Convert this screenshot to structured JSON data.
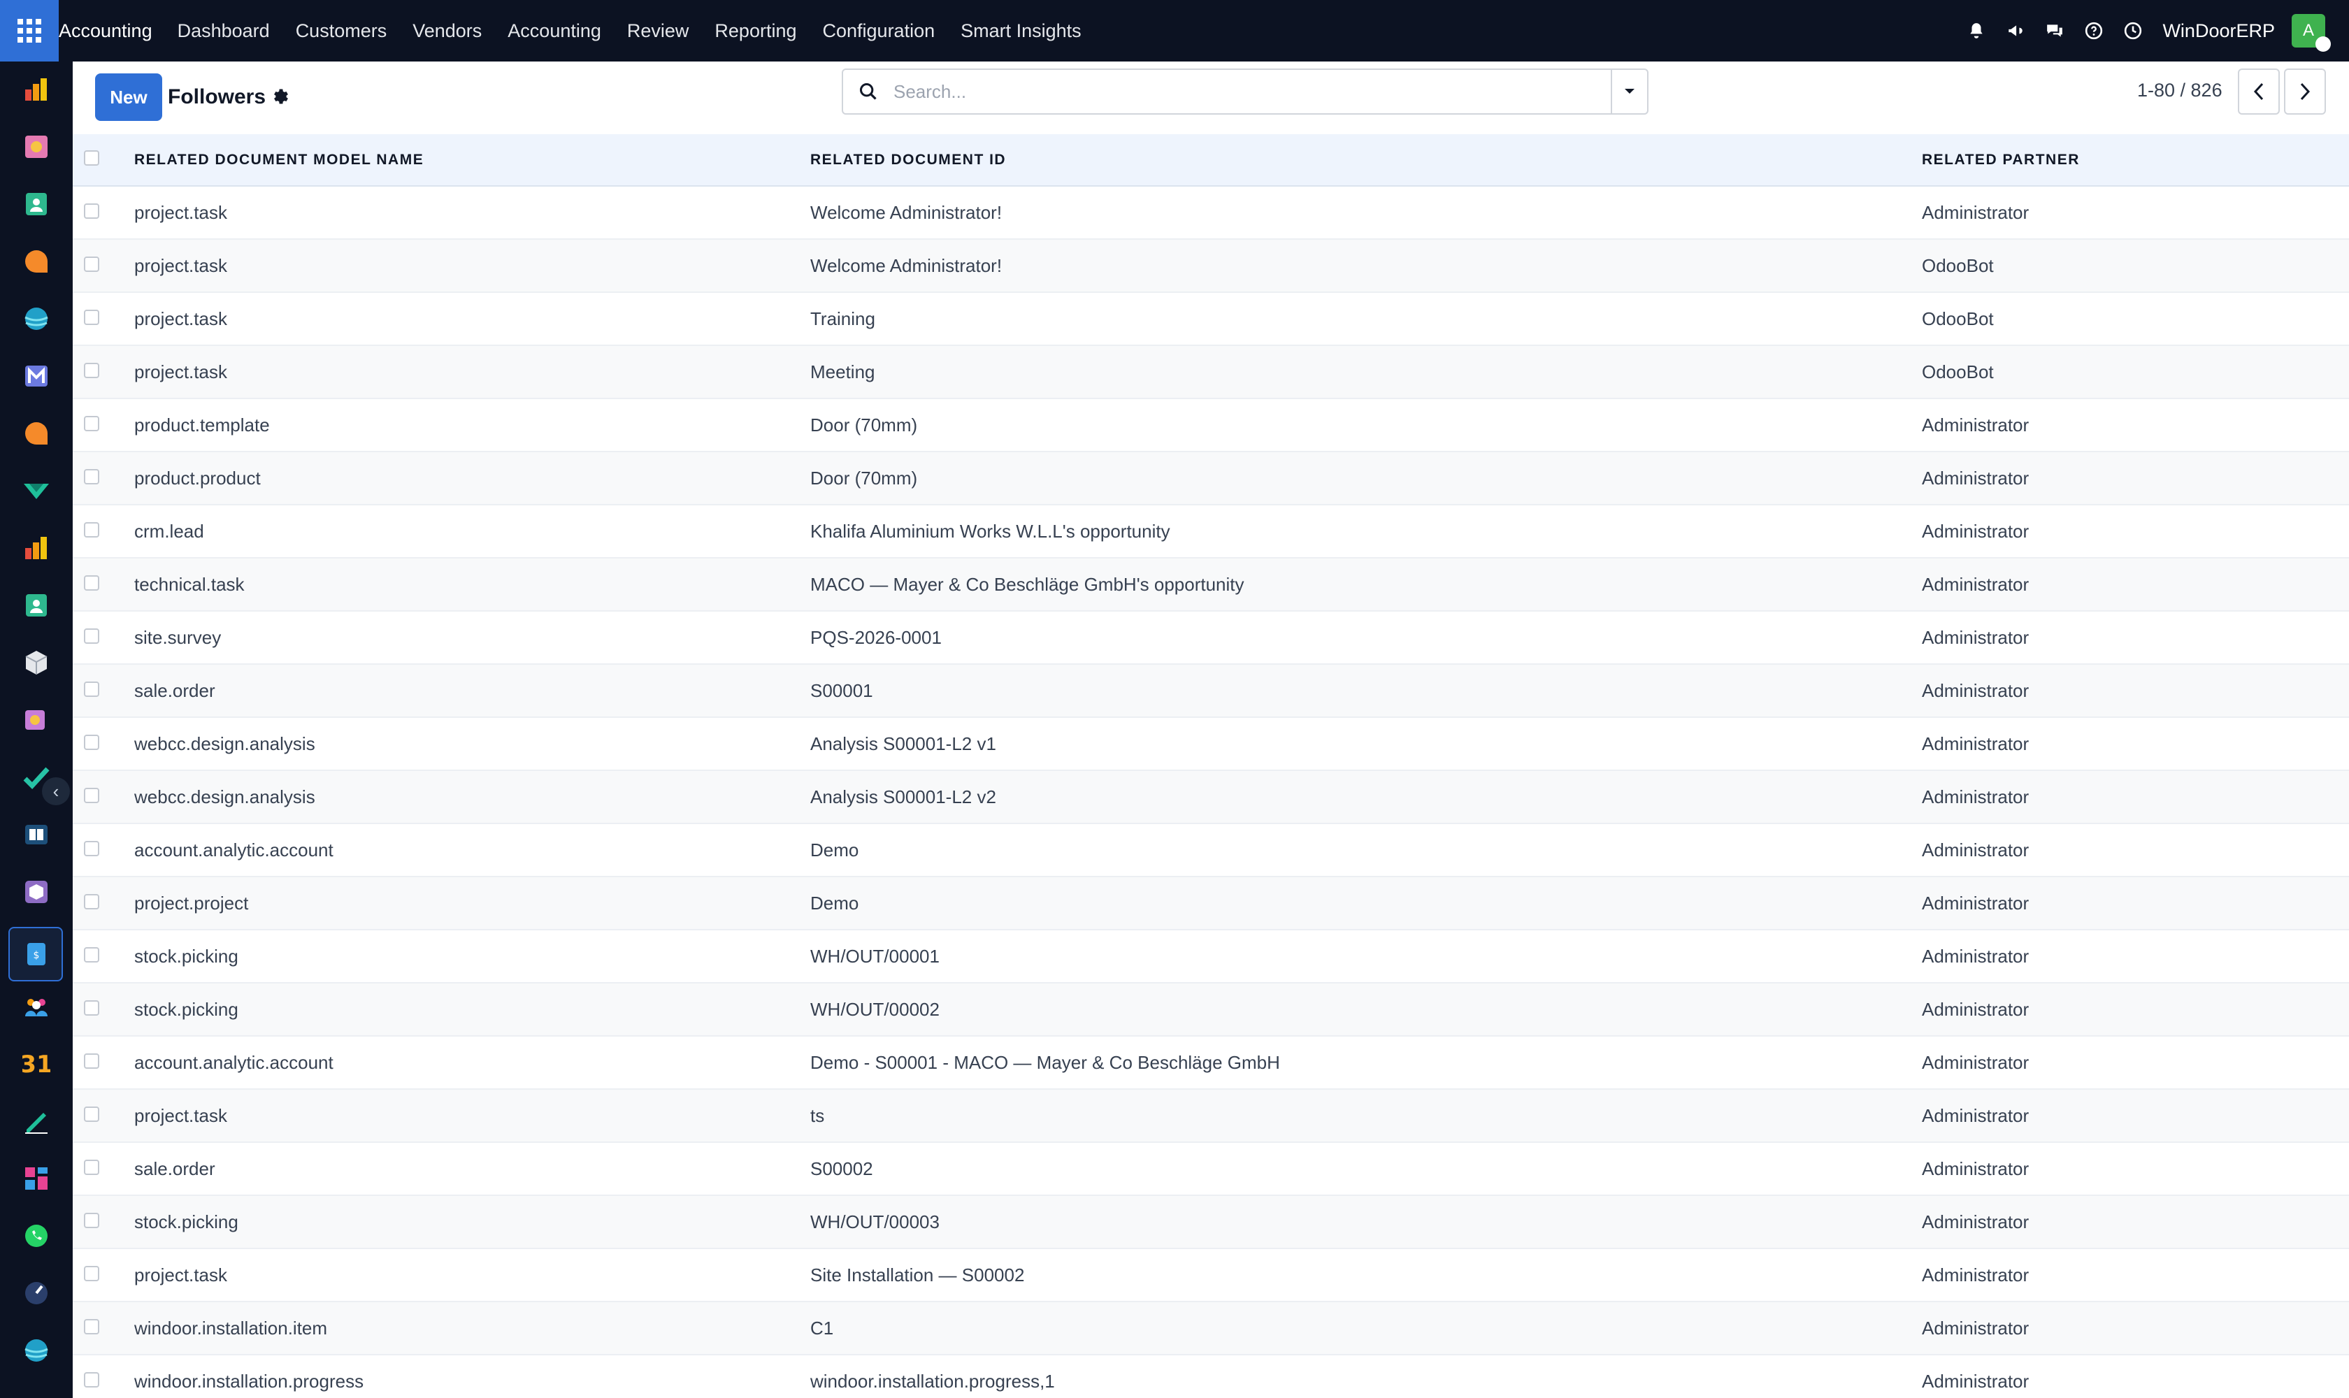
{
  "navbar": {
    "brand": "Accounting",
    "menu": [
      "Dashboard",
      "Customers",
      "Vendors",
      "Accounting",
      "Review",
      "Reporting",
      "Configuration",
      "Smart Insights"
    ],
    "company": "WinDoorERP",
    "avatar_initial": "A"
  },
  "control_panel": {
    "new_label": "New",
    "title": "Followers",
    "search_placeholder": "Search...",
    "pager": "1-80 / 826"
  },
  "table": {
    "columns": [
      "RELATED DOCUMENT MODEL NAME",
      "RELATED DOCUMENT ID",
      "RELATED PARTNER"
    ],
    "rows": [
      [
        "project.task",
        "Welcome Administrator!",
        "Administrator"
      ],
      [
        "project.task",
        "Welcome Administrator!",
        "OdooBot"
      ],
      [
        "project.task",
        "Training",
        "OdooBot"
      ],
      [
        "project.task",
        "Meeting",
        "OdooBot"
      ],
      [
        "product.template",
        "Door (70mm)",
        "Administrator"
      ],
      [
        "product.product",
        "Door (70mm)",
        "Administrator"
      ],
      [
        "crm.lead",
        "Khalifa Aluminium Works W.L.L's opportunity",
        "Administrator"
      ],
      [
        "technical.task",
        "MACO — Mayer & Co Beschläge GmbH's opportunity",
        "Administrator"
      ],
      [
        "site.survey",
        "PQS-2026-0001",
        "Administrator"
      ],
      [
        "sale.order",
        "S00001",
        "Administrator"
      ],
      [
        "webcc.design.analysis",
        "Analysis S00001-L2 v1",
        "Administrator"
      ],
      [
        "webcc.design.analysis",
        "Analysis S00001-L2 v2",
        "Administrator"
      ],
      [
        "account.analytic.account",
        "Demo",
        "Administrator"
      ],
      [
        "project.project",
        "Demo",
        "Administrator"
      ],
      [
        "stock.picking",
        "WH/OUT/00001",
        "Administrator"
      ],
      [
        "stock.picking",
        "WH/OUT/00002",
        "Administrator"
      ],
      [
        "account.analytic.account",
        "Demo - S00001 - MACO — Mayer & Co Beschläge GmbH",
        "Administrator"
      ],
      [
        "project.task",
        "ts",
        "Administrator"
      ],
      [
        "sale.order",
        "S00002",
        "Administrator"
      ],
      [
        "stock.picking",
        "WH/OUT/00003",
        "Administrator"
      ],
      [
        "project.task",
        "Site Installation — S00002",
        "Administrator"
      ],
      [
        "windoor.installation.item",
        "C1",
        "Administrator"
      ],
      [
        "windoor.installation.progress",
        "windoor.installation.progress,1",
        "Administrator"
      ]
    ]
  },
  "sidebar_calendar_label": "31",
  "colors": {
    "navbar": "#0c1222",
    "primary": "#2f6fd6",
    "header_row": "#eef4fd"
  }
}
